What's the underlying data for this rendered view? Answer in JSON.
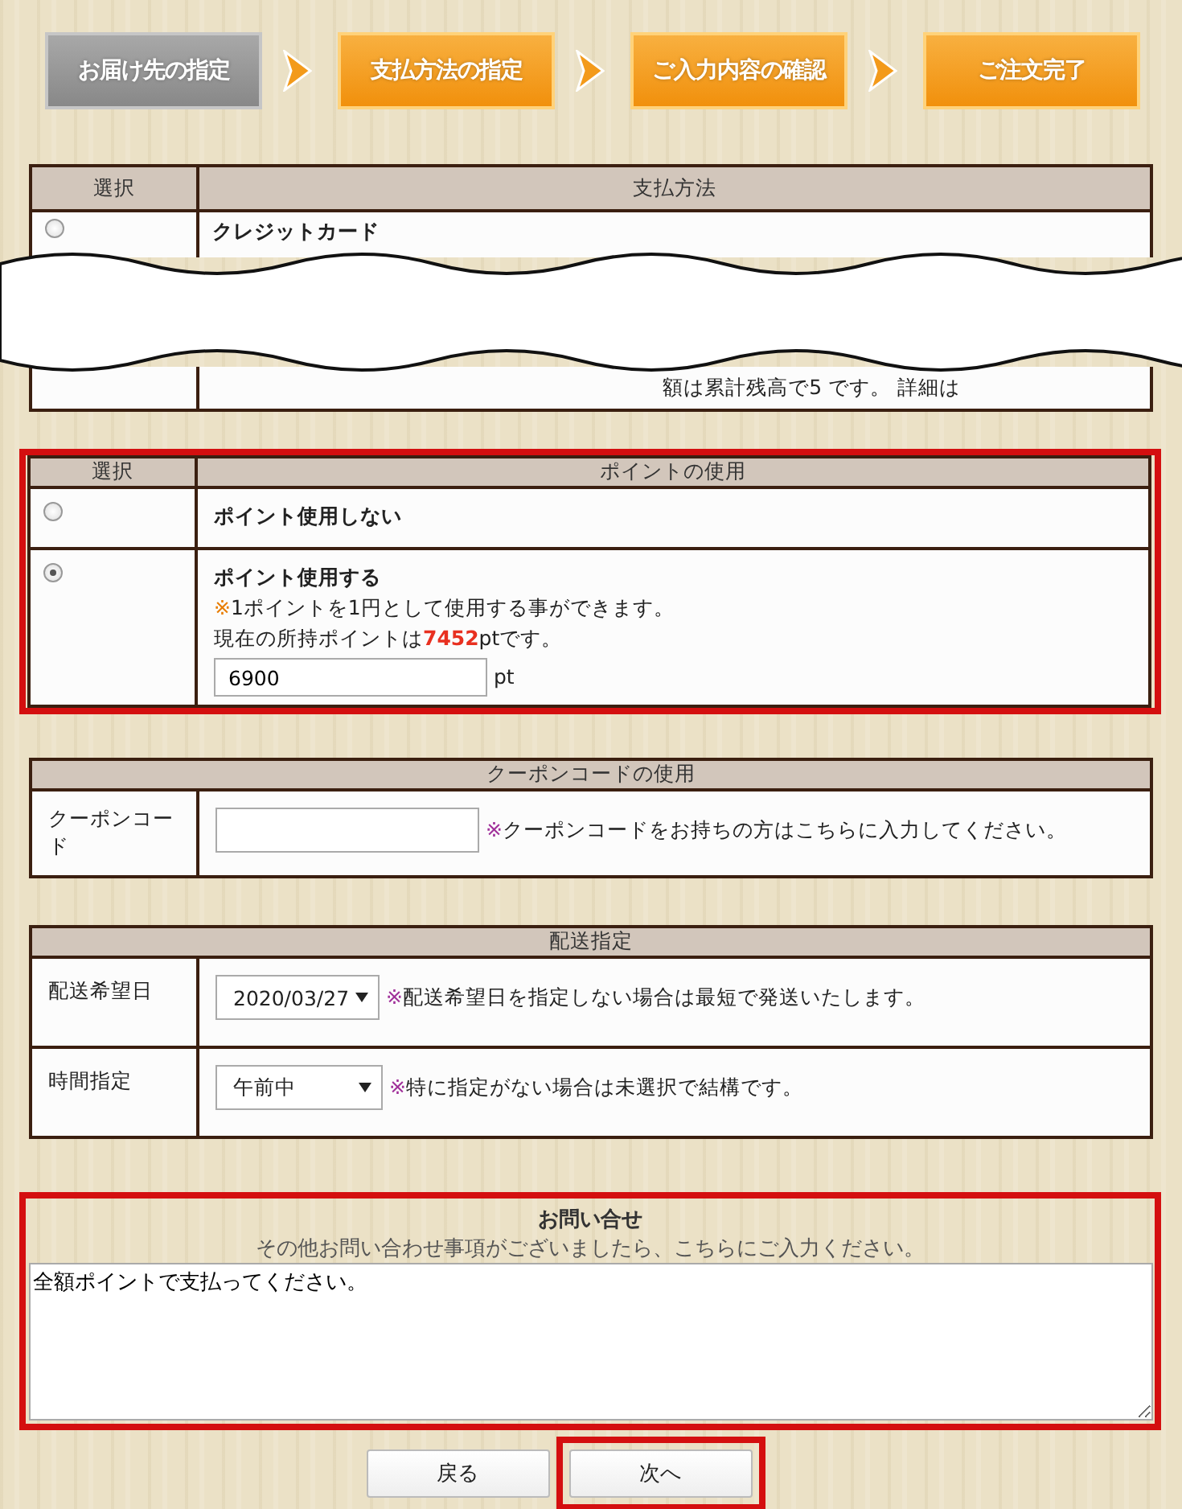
{
  "steps": [
    {
      "label": "お届け先の指定",
      "selected": true
    },
    {
      "label": "支払方法の指定",
      "selected": false
    },
    {
      "label": "ご入力内容の確認",
      "selected": false
    },
    {
      "label": "ご注文完了",
      "selected": false
    }
  ],
  "payment": {
    "columns": [
      "選択",
      "支払方法"
    ],
    "rows": [
      {
        "selected": false,
        "label": "クレジットカード",
        "fragment": "額は累計残高で5",
        "fragment_2": "です。 詳細は"
      }
    ]
  },
  "points": {
    "highlighted": true,
    "columns": [
      "選択",
      "ポイントの使用"
    ],
    "options": [
      {
        "kind": "plain",
        "selected": false,
        "label": "ポイント使用しない"
      },
      {
        "kind": "amount",
        "selected": true,
        "label": "ポイント使用する",
        "note_mark": "※",
        "note": "1ポイントを1円として使用する事ができます。",
        "balance_prefix": "現在の所持ポイントは",
        "balance_value": "7452",
        "balance_suffix": "ptです。",
        "value": "6900",
        "unit": "pt"
      }
    ]
  },
  "coupon": {
    "title": "クーポンコードの使用",
    "label": "クーポンコード",
    "note_mark": "※",
    "note": "クーポンコードをお持ちの方はこちらに入力してください。"
  },
  "delivery": {
    "title": "配送指定",
    "rows": [
      {
        "label": "配送希望日",
        "value": "2020/03/27",
        "note_mark": "※",
        "note": "配送希望日を指定しない場合は最短で発送いたします。"
      },
      {
        "label": "時間指定",
        "value": "午前中",
        "note_mark": "※",
        "note": "特に指定がない場合は未選択で結構です。"
      }
    ]
  },
  "inquiry": {
    "highlighted": true,
    "title": "お問い合せ",
    "subtitle": "その他お問い合わせ事項がございましたら、こちらにご入力ください。",
    "value": "全額ポイントで支払ってください。"
  },
  "buttons": [
    {
      "label": "戻る",
      "highlighted": false
    },
    {
      "label": "次へ",
      "highlighted": true
    }
  ]
}
